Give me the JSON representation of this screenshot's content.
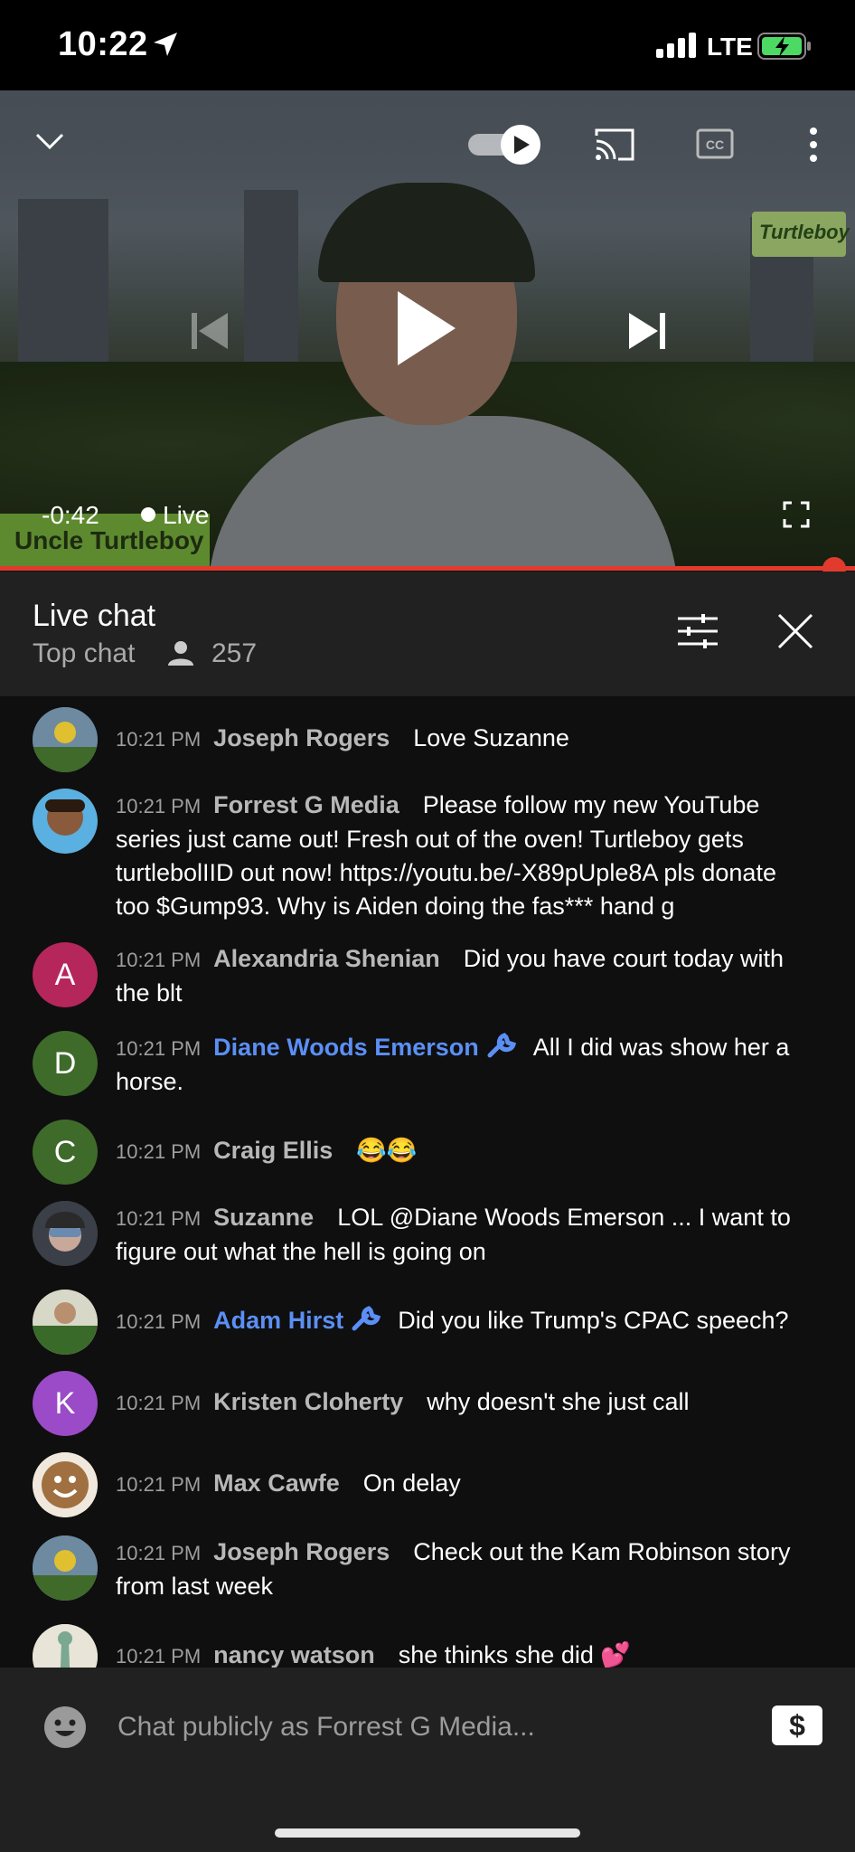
{
  "status": {
    "time": "10:22",
    "network": "LTE",
    "icons": [
      "location-arrow-icon",
      "signal-bars-icon",
      "battery-charging-icon"
    ]
  },
  "video": {
    "remaining_time": "-0:42",
    "live_label": "Live",
    "channel_overlay": "Uncle Turtleboy",
    "logo_text": "Turtleboy",
    "progress": 0.99,
    "icons": [
      "chevron-down-icon",
      "autoplay-toggle-icon",
      "cast-icon",
      "captions-icon",
      "more-vert-icon",
      "previous-icon",
      "play-icon",
      "next-icon",
      "fullscreen-icon"
    ]
  },
  "chat_header": {
    "title": "Live chat",
    "mode": "Top chat",
    "viewer_count": "257"
  },
  "messages": [
    {
      "time": "10:21 PM",
      "author": "Joseph Rogers",
      "text": "Love Suzanne",
      "avatar_letter": "",
      "moderator": false
    },
    {
      "time": "10:21 PM",
      "author": "Forrest G Media",
      "text": "Please follow my new YouTube series just came out! Fresh out of the oven! Turtleboy gets turtlebolIID out now! https://youtu.be/-X89pUple8A pls donate too $Gump93. Why is Aiden doing the fas*** hand g",
      "avatar_letter": "",
      "moderator": false
    },
    {
      "time": "10:21 PM",
      "author": "Alexandria Shenian",
      "text": "Did you have court today with the blt",
      "avatar_letter": "A",
      "moderator": false
    },
    {
      "time": "10:21 PM",
      "author": "Diane Woods Emerson",
      "text": "All I did was show her a horse.",
      "avatar_letter": "D",
      "moderator": true
    },
    {
      "time": "10:21 PM",
      "author": "Craig Ellis",
      "text": "😂😂",
      "avatar_letter": "C",
      "moderator": false
    },
    {
      "time": "10:21 PM",
      "author": "Suzanne",
      "text": "LOL @Diane Woods Emerson ... I want to figure out what the hell is going on",
      "avatar_letter": "",
      "moderator": false
    },
    {
      "time": "10:21 PM",
      "author": "Adam Hirst",
      "text": "Did you like Trump's CPAC speech?",
      "avatar_letter": "",
      "moderator": true
    },
    {
      "time": "10:21 PM",
      "author": "Kristen Cloherty",
      "text": "why doesn't she just call",
      "avatar_letter": "K",
      "moderator": false
    },
    {
      "time": "10:21 PM",
      "author": "Max Cawfe",
      "text": "On delay",
      "avatar_letter": "",
      "moderator": false
    },
    {
      "time": "10:21 PM",
      "author": "Joseph Rogers",
      "text": "Check out the Kam Robinson story from last week",
      "avatar_letter": "",
      "moderator": false
    },
    {
      "time": "10:21 PM",
      "author": "nancy watson",
      "text": "she thinks she did 💕",
      "avatar_letter": "",
      "moderator": false
    }
  ],
  "input": {
    "placeholder": "Chat publicly as Forrest G Media...",
    "value": ""
  },
  "colors": {
    "accent": "#e23b2e",
    "moderator": "#5b8ff5",
    "avatar_a": "#b5275a",
    "avatar_d": "#3e6b2a",
    "avatar_c": "#3e6b2a",
    "avatar_k": "#9b4bc7"
  }
}
